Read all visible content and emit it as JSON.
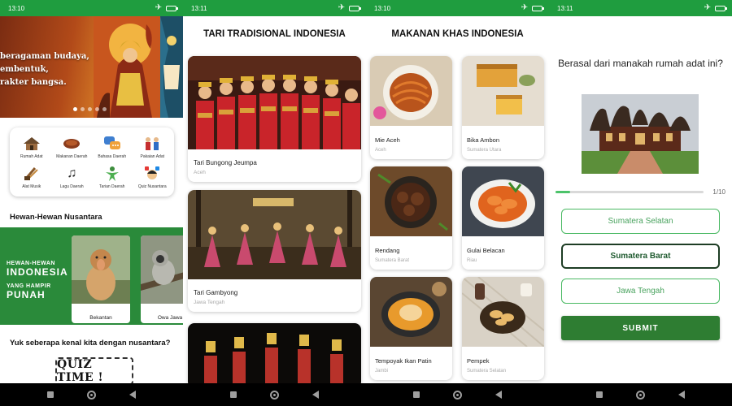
{
  "screens": [
    {
      "status_time": "13:10",
      "hero": {
        "lines": [
          "beragaman budaya,",
          "embentuk,",
          "rakter bangsa."
        ],
        "dot_count": 5,
        "active_dot": 0
      },
      "menu": [
        {
          "label": "Rumah Adat",
          "icon": "house-icon"
        },
        {
          "label": "Makanan Daerah",
          "icon": "food-bowl-icon"
        },
        {
          "label": "Bahasa Daerah",
          "icon": "speech-bubble-icon"
        },
        {
          "label": "Pakaian Adat",
          "icon": "traditional-clothes-icon"
        },
        {
          "label": "Alat Musik",
          "icon": "music-instrument-icon"
        },
        {
          "label": "Lagu Daerah",
          "icon": "music-note-icon"
        },
        {
          "label": "Tarian Daerah",
          "icon": "dancer-icon"
        },
        {
          "label": "Quiz Nusantara",
          "icon": "quiz-person-icon"
        }
      ],
      "fauna_section_title": "Hewan-Hewan Nusantara",
      "fauna_banner": {
        "line1": "HEWAN-HEWAN",
        "line2": "INDONESIA",
        "line3": "YANG HAMPIR",
        "line4": "PUNAH"
      },
      "fauna": [
        {
          "name": "Bekantan"
        },
        {
          "name": "Owa Jawa"
        }
      ],
      "quiz_prompt": "Yuk seberapa kenal kita dengan nusantara?",
      "quiz_badge": "QUIZ TIME !"
    },
    {
      "status_time": "13:11",
      "title": "TARI TRADISIONAL INDONESIA",
      "items": [
        {
          "name": "Tari Bungong Jeumpa",
          "region": "Aceh"
        },
        {
          "name": "Tari Gambyong",
          "region": "Jawa Tengah"
        }
      ]
    },
    {
      "status_time": "13:10",
      "title": "MAKANAN KHAS INDONESIA",
      "items": [
        {
          "name": "Mie Aceh",
          "region": "Aceh"
        },
        {
          "name": "Bika Ambon",
          "region": "Sumatera Utara"
        },
        {
          "name": "Rendang",
          "region": "Sumatera Barat"
        },
        {
          "name": "Gulai Belacan",
          "region": "Riau"
        },
        {
          "name": "Tempoyak Ikan Patin",
          "region": "Jambi"
        },
        {
          "name": "Pempek",
          "region": "Sumatera Selatan"
        }
      ]
    },
    {
      "status_time": "13:11",
      "question": "Berasal dari manakah rumah adat ini?",
      "progress": {
        "current": 1,
        "total": 10,
        "label": "1/10"
      },
      "answers": [
        {
          "label": "Sumatera Selatan",
          "selected": false
        },
        {
          "label": "Sumatera Barat",
          "selected": true
        },
        {
          "label": "Jawa Tengah",
          "selected": false
        }
      ],
      "submit_label": "SUBMIT"
    }
  ],
  "colors": {
    "status_bar": "#1f9d3f",
    "primary_green": "#2e7d32",
    "accent_green": "#49b962",
    "nav_bar": "#000000"
  }
}
